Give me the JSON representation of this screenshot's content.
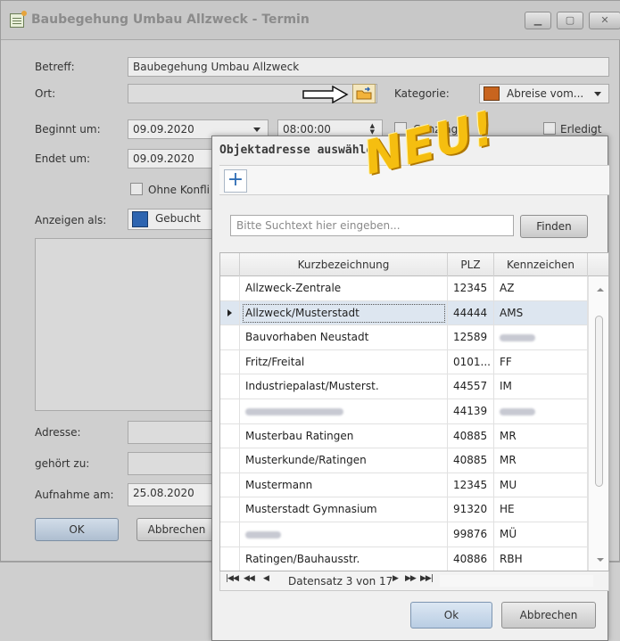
{
  "window": {
    "title": "Baubegehung Umbau Allzweck - Termin"
  },
  "form": {
    "betreff_label": "Betreff:",
    "betreff_value": "Baubegehung Umbau Allzweck",
    "ort_label": "Ort:",
    "ort_value": "",
    "kategorie_label": "Kategorie:",
    "kategorie_value": "Abreise vom...",
    "kategorie_color": "#c8641e",
    "beginnt_label": "Beginnt um:",
    "beginnt_date": "09.09.2020",
    "beginnt_time": "08:00:00",
    "ganztaegig_label": "Ganztägig",
    "erledigt_label": "Erledigt",
    "endet_label": "Endet um:",
    "endet_date": "09.09.2020",
    "ohne_konflikt_label": "Ohne Konfli",
    "anzeigen_label": "Anzeigen als:",
    "anzeigen_value": "Gebucht",
    "anzeigen_color": "#2d64b0",
    "adresse_label": "Adresse:",
    "gehoert_label": "gehört zu:",
    "aufnahme_label": "Aufnahme am:",
    "aufnahme_value": "25.08.2020",
    "ok_label": "OK",
    "cancel_label": "Abbrechen"
  },
  "stamp": {
    "text": "NEU!"
  },
  "dialog": {
    "title": "Objektadresse auswählen",
    "add_symbol": "+",
    "search_placeholder": "Bitte Suchtext hier eingeben...",
    "find_label": "Finden",
    "columns": [
      "Kurzbezeichnung",
      "PLZ",
      "Kennzeichen"
    ],
    "rows": [
      {
        "name": "Allzweck-Zentrale",
        "plz": "12345",
        "kz": "AZ"
      },
      {
        "name": "Allzweck/Musterstadt",
        "plz": "44444",
        "kz": "AMS"
      },
      {
        "name": "Bauvorhaben Neustadt",
        "plz": "12589",
        "kz": ""
      },
      {
        "name": "Fritz/Freital",
        "plz": "0101...",
        "kz": "FF"
      },
      {
        "name": "Industriepalast/Musterst.",
        "plz": "44557",
        "kz": "IM"
      },
      {
        "name": "",
        "plz": "44139",
        "kz": ""
      },
      {
        "name": "Musterbau Ratingen",
        "plz": "40885",
        "kz": "MR"
      },
      {
        "name": "Musterkunde/Ratingen",
        "plz": "40885",
        "kz": "MR"
      },
      {
        "name": "Mustermann",
        "plz": "12345",
        "kz": "MU"
      },
      {
        "name": "Musterstadt Gymnasium",
        "plz": "91320",
        "kz": "HE"
      },
      {
        "name": "",
        "plz": "99876",
        "kz": "MÜ"
      },
      {
        "name": "Ratingen/Bauhausstr.",
        "plz": "40886",
        "kz": "RBH"
      }
    ],
    "selected_row": 1,
    "navigator_text": "Datensatz 3 von 17",
    "ok_label": "Ok",
    "cancel_label": "Abbrechen"
  }
}
